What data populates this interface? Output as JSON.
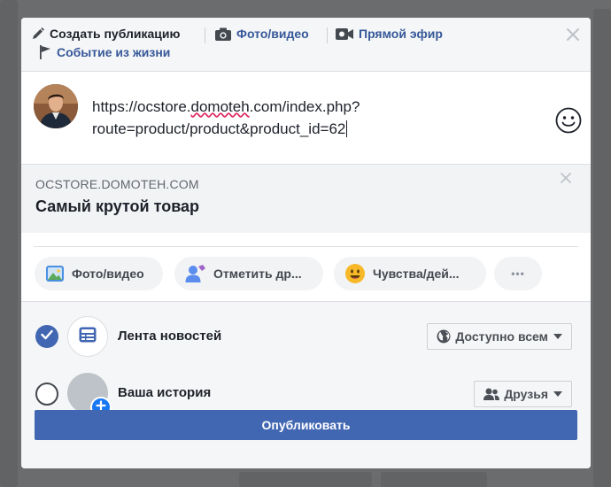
{
  "tabs": {
    "create_post": "Создать публикацию",
    "photo_video": "Фото/видео",
    "live_video": "Прямой эфир",
    "life_event": "Событие из жизни"
  },
  "composer": {
    "text_line1_prefix": "https://ocstore.",
    "text_line1_misspelled": "domoteh",
    "text_line1_suffix": ".com/index.php?",
    "text_line2": "route=product/product&product_id=62"
  },
  "link_preview": {
    "domain": "OCSTORE.DOMOTEH.COM",
    "title": "Самый крутой товар"
  },
  "actions": {
    "photo_video": "Фото/видео",
    "tag_friends": "Отметить др...",
    "feeling": "Чувства/дей...",
    "more": "•••"
  },
  "destinations": [
    {
      "label": "Лента новостей",
      "checked": true,
      "audience": "Доступно всем",
      "audience_icon": "globe-icon"
    },
    {
      "label": "Ваша история",
      "checked": false,
      "audience": "Друзья",
      "audience_icon": "friends-icon"
    }
  ],
  "publish_label": "Опубликовать",
  "colors": {
    "brand_blue": "#4267b2",
    "link_blue": "#365899",
    "panel_gray": "#f5f6f7",
    "overlay": "#6b6c6e"
  }
}
